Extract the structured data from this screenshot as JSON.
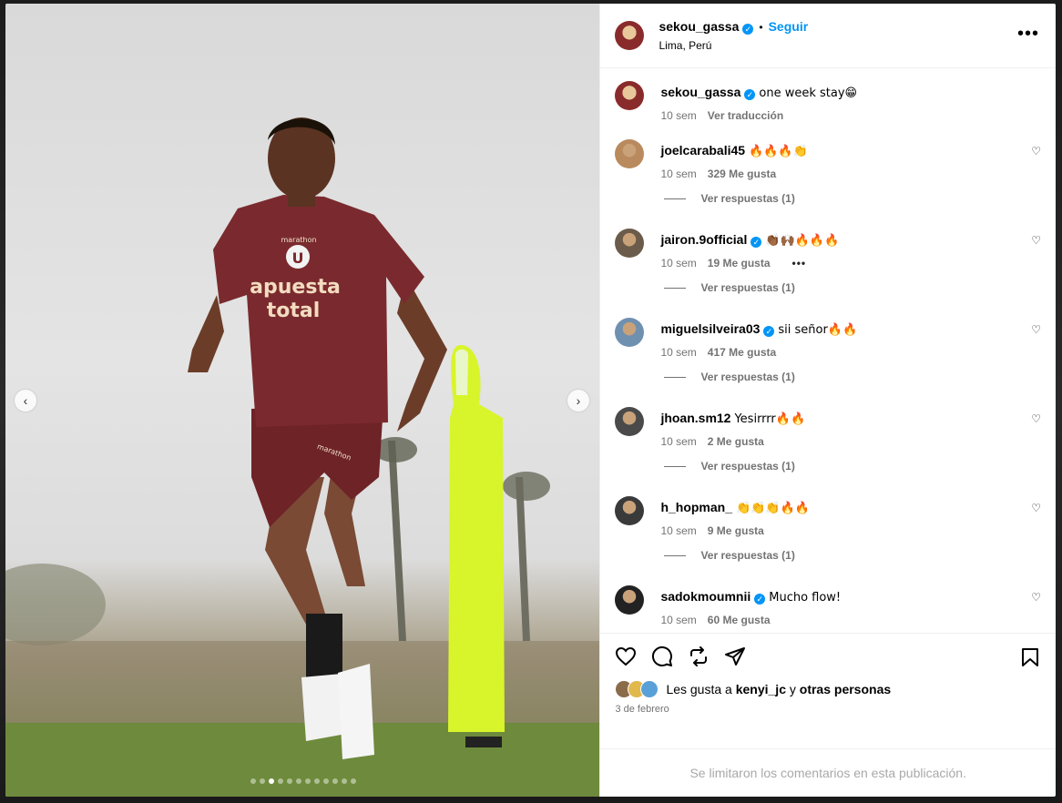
{
  "post": {
    "username": "sekou_gassa",
    "verified": true,
    "follow_label": "Seguir",
    "location": "Lima, Perú",
    "caption": "one week stay😁",
    "caption_time": "10 sem",
    "translate_label": "Ver traducción",
    "jersey_brand": "marathon",
    "jersey_sponsor_1": "apuesta",
    "jersey_sponsor_2": "total",
    "crest_letter": "U",
    "shorts_brand": "marathon",
    "carousel_total": 12,
    "carousel_index": 3
  },
  "comments": [
    {
      "user": "joelcarabali45",
      "verified": false,
      "text": "🔥🔥🔥👏",
      "time": "10 sem",
      "likes": "329 Me gusta",
      "replies": "Ver respuestas (1)"
    },
    {
      "user": "jairon.9official",
      "verified": true,
      "text": "👏🏾🙌🏾🔥🔥🔥",
      "time": "10 sem",
      "likes": "19 Me gusta",
      "more": "•••",
      "replies": "Ver respuestas (1)"
    },
    {
      "user": "miguelsilveira03",
      "verified": true,
      "text": "sii señor🔥🔥",
      "time": "10 sem",
      "likes": "417 Me gusta",
      "replies": "Ver respuestas (1)"
    },
    {
      "user": "jhoan.sm12",
      "verified": false,
      "text": "Yesirrrr🔥🔥",
      "time": "10 sem",
      "likes": "2 Me gusta",
      "replies": "Ver respuestas (1)"
    },
    {
      "user": "h_hopman_",
      "verified": false,
      "text": "👏👏👏🔥🔥",
      "time": "10 sem",
      "likes": "9 Me gusta",
      "replies": "Ver respuestas (1)"
    },
    {
      "user": "sadokmoumnii",
      "verified": true,
      "text": "Mucho flow!",
      "time": "10 sem",
      "likes": "60 Me gusta",
      "replies": ""
    }
  ],
  "likes_line": {
    "prefix": "Les gusta a",
    "user": "kenyi_jc",
    "joiner": "y",
    "others": "otras personas"
  },
  "post_date": "3 de febrero",
  "comments_limited": "Se limitaron los comentarios en esta publicación.",
  "colors": {
    "accent": "#0095f6",
    "jersey": "#7a2a2e",
    "mannequin": "#d8f52b"
  }
}
